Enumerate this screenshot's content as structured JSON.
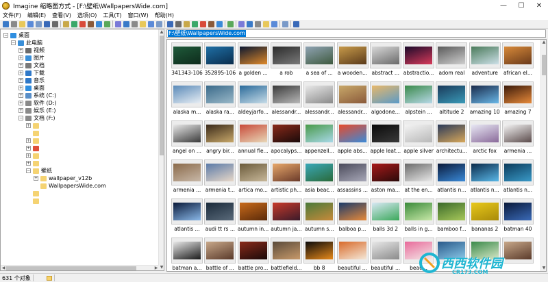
{
  "window": {
    "title": "Imagine 缩略图方式 - [F:\\壁纸\\WallpapersWide.com]",
    "minimize": "—",
    "maximize": "☐",
    "close": "✕"
  },
  "menu": [
    "文件(F)",
    "编辑(E)",
    "查看(V)",
    "选项(O)",
    "工具(T)",
    "窗口(W)",
    "帮助(H)"
  ],
  "toolbar_icons": [
    "open-folder-icon",
    "eye-icon",
    "folder-icon",
    "save-icon",
    "copy-icon",
    "save-as-icon",
    "print-icon",
    "sep",
    "scanner-icon",
    "convert-icon",
    "properties-icon",
    "cut-icon",
    "move-icon",
    "refresh-icon",
    "sep",
    "copy-to-icon",
    "paste-icon",
    "delete-icon",
    "move-to-icon",
    "folder-new-icon",
    "recycle-icon",
    "sep",
    "thumbnail-view-icon",
    "list-view-icon",
    "details-view-icon",
    "large-icons-icon",
    "small-icons-icon",
    "filmstrip-icon",
    "slideshow-icon",
    "sep",
    "wrench-icon",
    "sep",
    "zoom-in-icon",
    "zoom-out-icon",
    "fit-icon",
    "tile-icon",
    "screen-icon",
    "sep",
    "edit-icon",
    "sep",
    "help-icon"
  ],
  "tree": [
    {
      "label": "桌面",
      "level": 0,
      "expander": "−",
      "icon": "desktop-icon",
      "color": "#2f8ee0"
    },
    {
      "label": "此电脑",
      "level": 1,
      "expander": "−",
      "icon": "computer-icon",
      "color": "#3a8fd8"
    },
    {
      "label": "视频",
      "level": 2,
      "expander": "+",
      "icon": "video-folder-icon",
      "color": "#6b6b6b"
    },
    {
      "label": "图片",
      "level": 2,
      "expander": "+",
      "icon": "pictures-folder-icon",
      "color": "#3a8fd8"
    },
    {
      "label": "文档",
      "level": 2,
      "expander": "+",
      "icon": "documents-folder-icon",
      "color": "#7a7a7a"
    },
    {
      "label": "下载",
      "level": 2,
      "expander": "+",
      "icon": "download-folder-icon",
      "color": "#2f78c8"
    },
    {
      "label": "音乐",
      "level": 2,
      "expander": "+",
      "icon": "music-folder-icon",
      "color": "#2f78c8"
    },
    {
      "label": "桌面",
      "level": 2,
      "expander": "+",
      "icon": "desktop-folder-icon",
      "color": "#2f8ee0"
    },
    {
      "label": "系统 (C:)",
      "level": 2,
      "expander": "+",
      "icon": "drive-icon",
      "color": "#5a8fc8"
    },
    {
      "label": "软件 (D:)",
      "level": 2,
      "expander": "+",
      "icon": "drive-icon",
      "color": "#8a8a8a"
    },
    {
      "label": "娱乐 (E:)",
      "level": 2,
      "expander": "+",
      "icon": "drive-icon",
      "color": "#8a8a8a"
    },
    {
      "label": "文档 (F:)",
      "level": 2,
      "expander": "−",
      "icon": "drive-icon",
      "color": "#8a8a8a"
    },
    {
      "label": "",
      "level": 3,
      "expander": "+",
      "icon": "folder-icon",
      "color": "#f5d372"
    },
    {
      "label": "",
      "level": 3,
      "expander": "",
      "icon": "folder-icon",
      "color": "#f5d372"
    },
    {
      "label": "",
      "level": 3,
      "expander": "+",
      "icon": "folder-icon",
      "color": "#f5d372"
    },
    {
      "label": "",
      "level": 3,
      "expander": "+",
      "icon": "colorful-folder-icon",
      "color": "#e0503a"
    },
    {
      "label": "",
      "level": 3,
      "expander": "+",
      "icon": "folder-icon",
      "color": "#f5d372"
    },
    {
      "label": "",
      "level": 3,
      "expander": "+",
      "icon": "folder-icon",
      "color": "#f5d372"
    },
    {
      "label": "壁纸",
      "level": 3,
      "expander": "−",
      "icon": "folder-icon",
      "color": "#f5d372"
    },
    {
      "label": "wallpaper_v12b",
      "level": 4,
      "expander": "+",
      "icon": "folder-icon",
      "color": "#f5d372"
    },
    {
      "label": "WallpapersWide.com",
      "level": 4,
      "expander": "",
      "icon": "open-folder-icon",
      "color": "#f5d372",
      "selected": false
    },
    {
      "label": "",
      "level": 3,
      "expander": "",
      "icon": "folder-icon",
      "color": "#f5d372"
    },
    {
      "label": "",
      "level": 3,
      "expander": "",
      "icon": "folder-icon",
      "color": "#f5d372"
    }
  ],
  "path": "F:\\壁纸\\WallpapersWide.com",
  "thumbnails": [
    {
      "label": "341343-106",
      "colors": [
        "#1f5a3a",
        "#0e2b1c"
      ]
    },
    {
      "label": "352895-106",
      "colors": [
        "#1f6fa5",
        "#0a2d4d"
      ]
    },
    {
      "label": "a golden ...",
      "colors": [
        "#0b1730",
        "#e08a2a"
      ]
    },
    {
      "label": "a rob",
      "colors": [
        "#2b2b2b",
        "#7a7a7a"
      ]
    },
    {
      "label": "a sea of ...",
      "colors": [
        "#8fa3b3",
        "#3f5a3f"
      ]
    },
    {
      "label": "a wooden...",
      "colors": [
        "#c79a4a",
        "#5a3a1a"
      ]
    },
    {
      "label": "abstract ...",
      "colors": [
        "#d8d8d8",
        "#6a6a6a"
      ]
    },
    {
      "label": "abstractio...",
      "colors": [
        "#1a0a2a",
        "#d83a5a"
      ]
    },
    {
      "label": "adom real",
      "colors": [
        "#5a5a5a",
        "#cfcfcf"
      ]
    },
    {
      "label": "adventure",
      "colors": [
        "#4a7a5a",
        "#cde0e8"
      ]
    },
    {
      "label": "african el...",
      "colors": [
        "#d88a3a",
        "#6a3a1a"
      ]
    },
    {
      "label": "alaska m...",
      "colors": [
        "#5a8ab8",
        "#e8eef4"
      ]
    },
    {
      "label": "alaska ra...",
      "colors": [
        "#3a6a8a",
        "#9ab8c8"
      ]
    },
    {
      "label": "aldeyjarfo...",
      "colors": [
        "#2a6a9a",
        "#c8dde8"
      ]
    },
    {
      "label": "alessandr...",
      "colors": [
        "#3a3a3a",
        "#b8b8b8"
      ]
    },
    {
      "label": "alessandr...",
      "colors": [
        "#e8e8e8",
        "#8a8a8a"
      ]
    },
    {
      "label": "alessandr...",
      "colors": [
        "#c8a86a",
        "#8a5a3a"
      ]
    },
    {
      "label": "algodone...",
      "colors": [
        "#e8b86a",
        "#5a9ac8"
      ]
    },
    {
      "label": "alpstein ...",
      "colors": [
        "#3a8a4a",
        "#b8d8e8"
      ]
    },
    {
      "label": "altitude 2",
      "colors": [
        "#1a3a5a",
        "#3a9ab8"
      ]
    },
    {
      "label": "amazing 10",
      "colors": [
        "#1a2a4a",
        "#6ab8e8"
      ]
    },
    {
      "label": "amazing 7",
      "colors": [
        "#3a1a0a",
        "#e88a3a"
      ]
    },
    {
      "label": "angel on ...",
      "colors": [
        "#e8e8e8",
        "#3a3a3a"
      ]
    },
    {
      "label": "angry bir...",
      "colors": [
        "#3a2a1a",
        "#c8a86a"
      ]
    },
    {
      "label": "annual fle...",
      "colors": [
        "#c84a3a",
        "#e8d8b8"
      ]
    },
    {
      "label": "apocalyps...",
      "colors": [
        "#8a2a1a",
        "#1a0a0a"
      ]
    },
    {
      "label": "appenzell...",
      "colors": [
        "#4a9a4a",
        "#a8d8e8"
      ]
    },
    {
      "label": "apple abs...",
      "colors": [
        "#e84a2a",
        "#3a8ad8"
      ]
    },
    {
      "label": "apple leat...",
      "colors": [
        "#0a0a0a",
        "#3a3a3a"
      ]
    },
    {
      "label": "apple silver",
      "colors": [
        "#f4f4f4",
        "#b8b8b8"
      ]
    },
    {
      "label": "architectu...",
      "colors": [
        "#2a3a5a",
        "#d8a85a"
      ]
    },
    {
      "label": "arctic fox",
      "colors": [
        "#e8e8f4",
        "#8a6a9a"
      ]
    },
    {
      "label": "armenia ...",
      "colors": [
        "#f4f4f4",
        "#5a4a4a"
      ]
    },
    {
      "label": "armenia ...",
      "colors": [
        "#8a6a4a",
        "#c8b8a8"
      ]
    },
    {
      "label": "armenia t...",
      "colors": [
        "#5a7aa8",
        "#e8d8c8"
      ]
    },
    {
      "label": "artica mo...",
      "colors": [
        "#6a5a3a",
        "#c8b89a"
      ]
    },
    {
      "label": "artistic ph...",
      "colors": [
        "#e8a86a",
        "#6a3a2a"
      ]
    },
    {
      "label": "asia beac...",
      "colors": [
        "#3aa8b8",
        "#2a6a3a"
      ]
    },
    {
      "label": "assassins ...",
      "colors": [
        "#4a4a5a",
        "#a8a8b8"
      ]
    },
    {
      "label": "aston ma...",
      "colors": [
        "#a81a1a",
        "#2a0a0a"
      ]
    },
    {
      "label": "at the en...",
      "colors": [
        "#6a6a6a",
        "#e8e8e8"
      ]
    },
    {
      "label": "atlantis n...",
      "colors": [
        "#0a1a3a",
        "#3a8ad8"
      ]
    },
    {
      "label": "atlantis n...",
      "colors": [
        "#0a2a4a",
        "#5ab8e8"
      ]
    },
    {
      "label": "atlantis n...",
      "colors": [
        "#0a3a5a",
        "#3a9ac8"
      ]
    },
    {
      "label": "atlantis ...",
      "colors": [
        "#0a1a3a",
        "#8ab8e8"
      ]
    },
    {
      "label": "audi tt rs ...",
      "colors": [
        "#1a2a3a",
        "#5a6a7a"
      ]
    },
    {
      "label": "autumn in...",
      "colors": [
        "#c86a1a",
        "#5a2a0a"
      ]
    },
    {
      "label": "autumn ja...",
      "colors": [
        "#c83a2a",
        "#3a1a2a"
      ]
    },
    {
      "label": "autumn s...",
      "colors": [
        "#4a7a3a",
        "#c88a3a"
      ]
    },
    {
      "label": "balboa p...",
      "colors": [
        "#1a3a6a",
        "#e88a3a"
      ]
    },
    {
      "label": "balls 3d 2",
      "colors": [
        "#d8e8f4",
        "#3aa85a"
      ]
    },
    {
      "label": "balls in g...",
      "colors": [
        "#3a8a3a",
        "#c8e8a8"
      ]
    },
    {
      "label": "bamboo f...",
      "colors": [
        "#3a6a2a",
        "#a8c85a"
      ]
    },
    {
      "label": "bananas 2",
      "colors": [
        "#e8c81a",
        "#a88a0a"
      ]
    },
    {
      "label": "batman 40",
      "colors": [
        "#0a1a3a",
        "#3a6ab8"
      ]
    },
    {
      "label": "batman a...",
      "colors": [
        "#e8e8e8",
        "#1a1a1a"
      ]
    },
    {
      "label": "battle of ...",
      "colors": [
        "#c8a88a",
        "#5a3a2a"
      ]
    },
    {
      "label": "battle pro...",
      "colors": [
        "#8a2a1a",
        "#1a0a0a"
      ]
    },
    {
      "label": "battlefield...",
      "colors": [
        "#5a4a3a",
        "#c89a6a"
      ]
    },
    {
      "label": "bb 8",
      "colors": [
        "#0a0a0a",
        "#e88a1a"
      ]
    },
    {
      "label": "beautiful ...",
      "colors": [
        "#d86a2a",
        "#f4e8d8"
      ]
    },
    {
      "label": "beautiful ...",
      "colors": [
        "#e8e8e8",
        "#8a8a8a"
      ]
    },
    {
      "label": "beau...",
      "colors": [
        "#e86a9a",
        "#f4e8e8"
      ]
    },
    {
      "label": "",
      "colors": [
        "#2a5a8a",
        "#8ac8e8"
      ]
    },
    {
      "label": "",
      "colors": [
        "#3a8a4a",
        "#d8e8c8"
      ]
    },
    {
      "label": "",
      "colors": [
        "#c8a88a",
        "#5a3a2a"
      ]
    }
  ],
  "status": {
    "count": "631 个对象"
  },
  "watermark": {
    "text": "西西软件园",
    "sub": "CR173.COM"
  }
}
